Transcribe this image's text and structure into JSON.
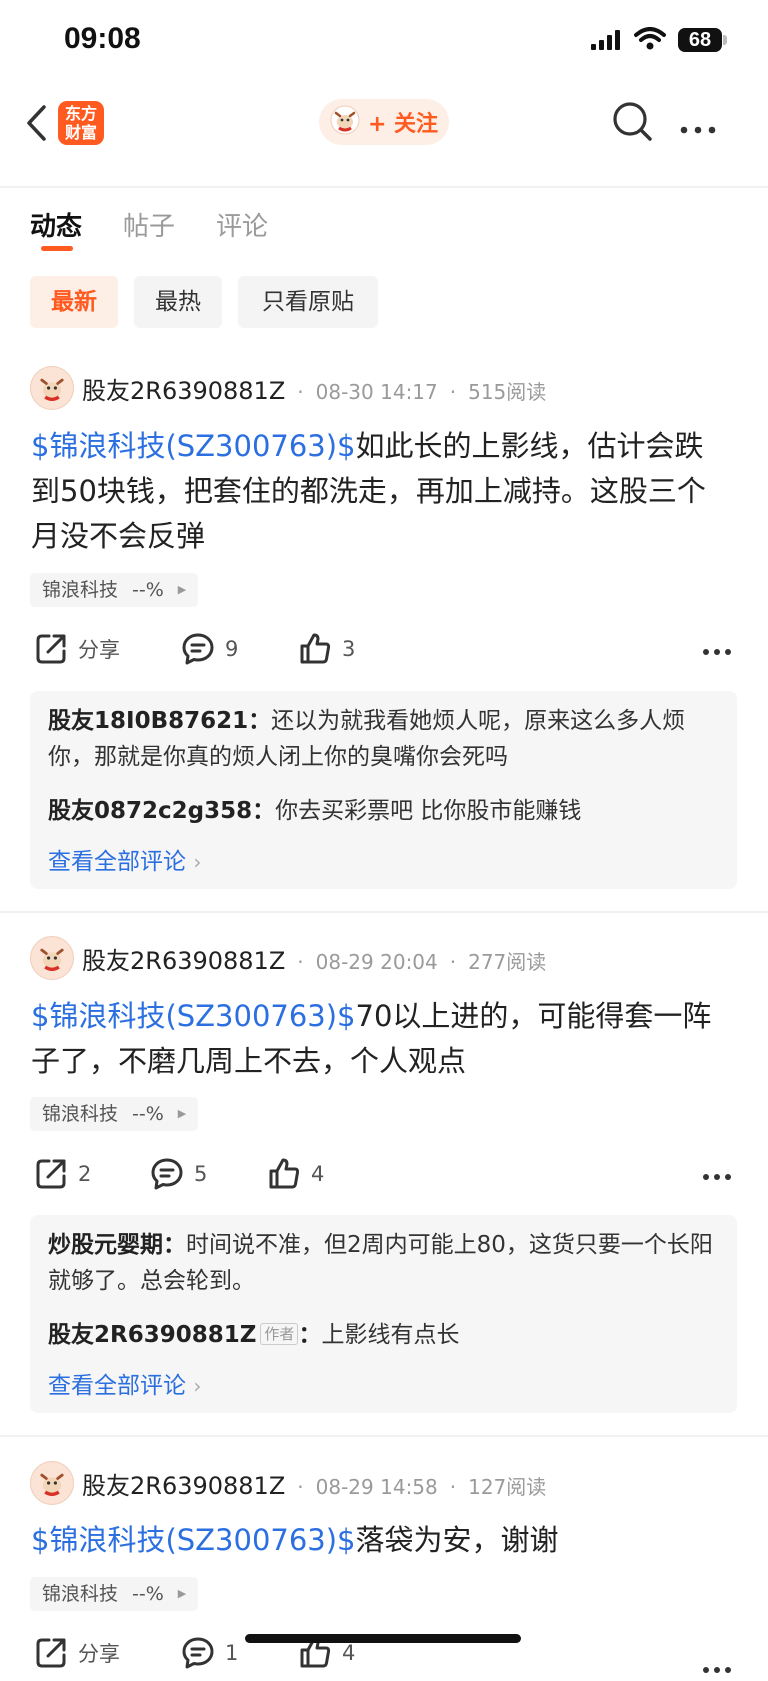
{
  "status_bar": {
    "time": "09:08",
    "battery": "68"
  },
  "nav": {
    "logo_line1": "东方",
    "logo_line2": "财富",
    "follow_label": "+ 关注"
  },
  "tabs": [
    {
      "label": "动态",
      "active": true
    },
    {
      "label": "帖子",
      "active": false
    },
    {
      "label": "评论",
      "active": false
    }
  ],
  "filters": [
    {
      "label": "最新",
      "active": true
    },
    {
      "label": "最热",
      "active": false
    },
    {
      "label": "只看原贴",
      "active": false
    }
  ],
  "posts": [
    {
      "author": "股友2R6390881Z",
      "date": "08-30 14:17",
      "reads": "515阅读",
      "stock_link": "$锦浪科技(SZ300763)$",
      "text": "如此长的上影线，估计会跌到50块钱，把套住的都洗走，再加上减持。这股三个月没不会反弹",
      "stock_tag": "锦浪科技",
      "stock_change": "--%",
      "share": "分享",
      "comments": "9",
      "likes": "3",
      "replies": [
        {
          "user": "股友18I0B87621",
          "author_badge": "",
          "text": "还以为就我看她烦人呢，原来这么多人烦你，那就是你真的烦人闭上你的臭嘴你会死吗"
        },
        {
          "user": "股友0872c2g358",
          "author_badge": "",
          "text": "你去买彩票吧 比你股市能赚钱"
        }
      ],
      "view_all": "查看全部评论"
    },
    {
      "author": "股友2R6390881Z",
      "date": "08-29 20:04",
      "reads": "277阅读",
      "stock_link": "$锦浪科技(SZ300763)$",
      "text": "70以上进的，可能得套一阵子了，不磨几周上不去，个人观点",
      "stock_tag": "锦浪科技",
      "stock_change": "--%",
      "share": "2",
      "comments": "5",
      "likes": "4",
      "replies": [
        {
          "user": "炒股元婴期",
          "author_badge": "",
          "text": "时间说不准，但2周内可能上80，这货只要一个长阳就够了。总会轮到。"
        },
        {
          "user": "股友2R6390881Z",
          "author_badge": "作者",
          "text": "上影线有点长"
        }
      ],
      "view_all": "查看全部评论"
    },
    {
      "author": "股友2R6390881Z",
      "date": "08-29 14:58",
      "reads": "127阅读",
      "stock_link": "$锦浪科技(SZ300763)$",
      "text": "落袋为安，谢谢",
      "stock_tag": "锦浪科技",
      "stock_change": "--%",
      "share": "分享",
      "comments": "1",
      "likes": "4"
    }
  ],
  "colors": {
    "accent": "#ff5a1f",
    "link": "#2b6fe0"
  }
}
